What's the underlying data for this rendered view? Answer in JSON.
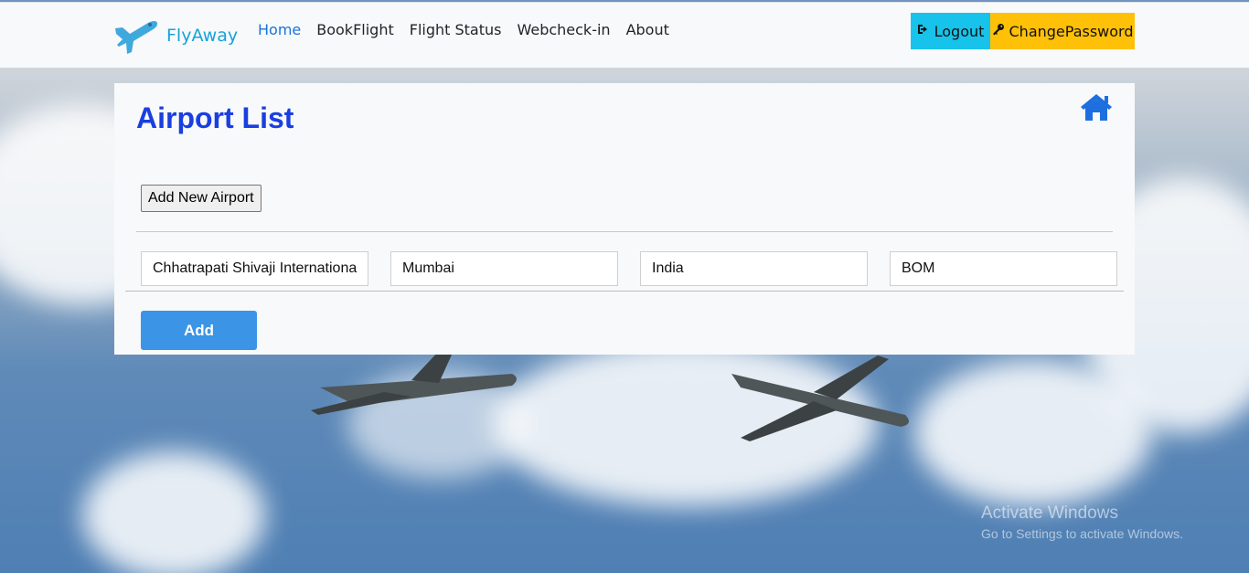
{
  "brand": {
    "name": "FlyAway",
    "logo_icon": "airplane-icon"
  },
  "nav": {
    "items": [
      {
        "label": "Home",
        "active": true
      },
      {
        "label": "BookFlight",
        "active": false
      },
      {
        "label": "Flight Status",
        "active": false
      },
      {
        "label": "Webcheck-in",
        "active": false
      },
      {
        "label": "About",
        "active": false
      }
    ]
  },
  "actions": {
    "logout_label": "Logout",
    "logout_icon": "sign-out-icon",
    "change_password_label": "ChangePassword",
    "change_password_icon": "key-icon"
  },
  "panel": {
    "title": "Airport List",
    "home_icon": "home-icon",
    "add_new_label": "Add New Airport",
    "fields": {
      "airport_name": "Chhatrapati Shivaji Internationa",
      "city": "Mumbai",
      "country": "India",
      "code": "BOM"
    },
    "add_label": "Add"
  },
  "watermark": {
    "line1": "Activate Windows",
    "line2": "Go to Settings to activate Windows."
  },
  "colors": {
    "accent_blue": "#1a3fe0",
    "logout_bg": "#17c3ea",
    "change_password_bg": "#ffc107",
    "add_button_bg": "#3b94e6"
  }
}
